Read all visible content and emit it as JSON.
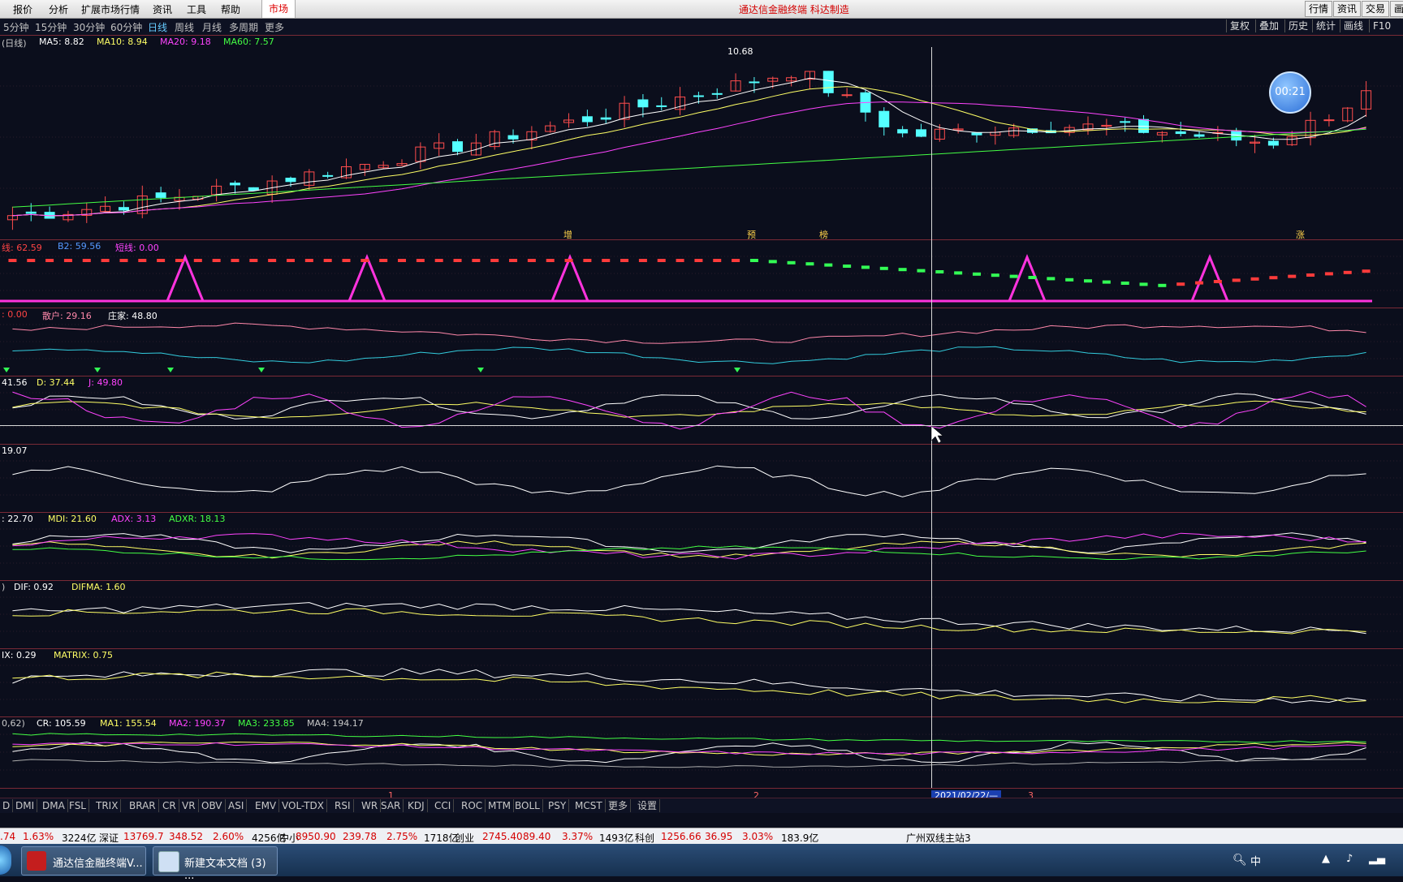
{
  "menu": {
    "items": [
      "报价",
      "分析",
      "扩展市场行情",
      "资讯",
      "工具",
      "帮助"
    ],
    "market": "市场",
    "title": "通达信金融终端  科达制造",
    "right_buttons": [
      "行情",
      "资讯",
      "交易",
      "画线"
    ]
  },
  "periods": {
    "items": [
      "5分钟",
      "15分钟",
      "30分钟",
      "60分钟",
      "日线",
      "周线",
      "月线",
      "多周期",
      "更多"
    ],
    "active_index": 4,
    "right_buttons": [
      "复权",
      "叠加",
      "历史",
      "统计",
      "画线",
      "F10"
    ]
  },
  "timer": "00:21",
  "panels": [
    {
      "name": "main",
      "legend": [
        {
          "text": "(日线)",
          "color": "#c8c8c8"
        },
        {
          "text": "MA5: 8.82",
          "color": "#ffffff"
        },
        {
          "text": "MA10: 8.94",
          "color": "#ffff66"
        },
        {
          "text": "MA20: 9.18",
          "color": "#ff44ff"
        },
        {
          "text": "MA60: 7.57",
          "color": "#44ff44"
        }
      ]
    },
    {
      "name": "ind1",
      "legend": [
        {
          "text": "线: 62.59",
          "color": "#ff4444"
        },
        {
          "text": "B2: 59.56",
          "color": "#5599ff"
        },
        {
          "text": "短线: 0.00",
          "color": "#ff44ff"
        }
      ]
    },
    {
      "name": "ind2",
      "legend": [
        {
          "text": ": 0.00",
          "color": "#ff4444"
        },
        {
          "text": "散户: 29.16",
          "color": "#ff88aa"
        },
        {
          "text": "庄家: 48.80",
          "color": "#ffffff"
        }
      ]
    },
    {
      "name": "kdj",
      "legend": [
        {
          "text": "41.56",
          "color": "#ffffff"
        },
        {
          "text": "D: 37.44",
          "color": "#ffff66"
        },
        {
          "text": "J: 49.80",
          "color": "#ff44ff"
        }
      ]
    },
    {
      "name": "ind4",
      "legend": [
        {
          "text": "19.07",
          "color": "#ffffff"
        }
      ]
    },
    {
      "name": "dmi",
      "legend": [
        {
          "text": ": 22.70",
          "color": "#ffffff"
        },
        {
          "text": "MDI: 21.60",
          "color": "#ffff66"
        },
        {
          "text": "ADX: 3.13",
          "color": "#ff44ff"
        },
        {
          "text": "ADXR: 18.13",
          "color": "#44ff44"
        }
      ]
    },
    {
      "name": "dma",
      "legend": [
        {
          "text": ")",
          "color": "#c8c8c8"
        },
        {
          "text": "DIF: 0.92",
          "color": "#ffffff"
        },
        {
          "text": "DIFMA: 1.60",
          "color": "#ffff66"
        }
      ]
    },
    {
      "name": "trix",
      "legend": [
        {
          "text": "IX: 0.29",
          "color": "#ffffff"
        },
        {
          "text": "MATRIX: 0.75",
          "color": "#ffff66"
        }
      ]
    },
    {
      "name": "cr",
      "legend": [
        {
          "text": "0,62)",
          "color": "#c8c8c8"
        },
        {
          "text": "CR: 105.59",
          "color": "#ffffff"
        },
        {
          "text": "MA1: 155.54",
          "color": "#ffff66"
        },
        {
          "text": "MA2: 190.37",
          "color": "#ff44ff"
        },
        {
          "text": "MA3: 233.85",
          "color": "#44ff44"
        },
        {
          "text": "MA4: 194.17",
          "color": "#c8c8c8"
        }
      ]
    }
  ],
  "high_label": "10.68",
  "markers": [
    "增",
    "预",
    "榜",
    "涨"
  ],
  "x_axis": {
    "ticks": [
      "1",
      "2",
      "3"
    ],
    "date": "2021/02/22/—"
  },
  "indicator_tabs": [
    "D",
    "DMI",
    "DMA",
    "FSL",
    "TRIX",
    "BRAR",
    "CR",
    "VR",
    "OBV",
    "ASI",
    "EMV",
    "VOL-TDX",
    "RSI",
    "WR",
    "SAR",
    "KDJ",
    "CCI",
    "ROC",
    "MTM",
    "BOLL",
    "PSY",
    "MCST",
    "更多",
    "设置"
  ],
  "status": [
    {
      "text": ".74",
      "red": true
    },
    {
      "text": "1.63%",
      "red": true
    },
    {
      "text": "3224亿",
      "red": false
    },
    {
      "text": "深证",
      "red": false
    },
    {
      "text": "13769.7",
      "red": true
    },
    {
      "text": "348.52",
      "red": true
    },
    {
      "text": "2.60%",
      "red": true
    },
    {
      "text": "4256亿",
      "red": false
    },
    {
      "text": "中小",
      "red": false
    },
    {
      "text": "8950.90",
      "red": true
    },
    {
      "text": "239.78",
      "red": true
    },
    {
      "text": "2.75%",
      "red": true
    },
    {
      "text": "1718亿",
      "red": false
    },
    {
      "text": "创业",
      "red": false
    },
    {
      "text": "2745.40",
      "red": true
    },
    {
      "text": "89.40",
      "red": true
    },
    {
      "text": "3.37%",
      "red": true
    },
    {
      "text": "1493亿",
      "red": false
    },
    {
      "text": "科创",
      "red": false
    },
    {
      "text": "1256.66",
      "red": true
    },
    {
      "text": "36.95",
      "red": true
    },
    {
      "text": "3.03%",
      "red": true
    },
    {
      "text": "183.9亿",
      "red": false
    },
    {
      "text": "广州双线主站3",
      "red": false
    }
  ],
  "taskbar": {
    "items": [
      "通达信金融终端V...",
      "新建文本文档 (3) ..."
    ],
    "ime": "中"
  }
}
